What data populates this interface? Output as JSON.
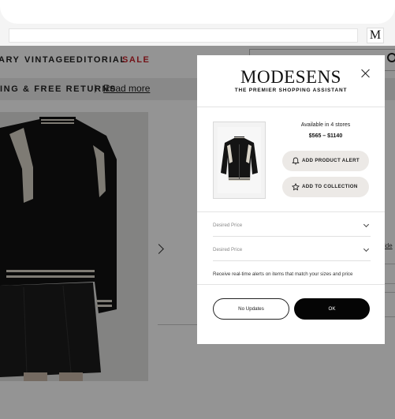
{
  "browser": {
    "extension_icon_letter": "M"
  },
  "nav": {
    "items": [
      {
        "label": "ARY"
      },
      {
        "label": "VINTAGE"
      },
      {
        "label": "EDITORIAL"
      },
      {
        "label": "SALE"
      }
    ]
  },
  "promo": {
    "text": "ING & FREE RETURNS",
    "separator": "|",
    "link": "Read more"
  },
  "page": {
    "size_link_fragment": "ide"
  },
  "modal": {
    "logo": "MODESENS",
    "tagline": "THE PREMIER SHOPPING ASSISTANT",
    "availability": "Available in 4 stores",
    "price_range": "$565 – $1140",
    "add_alert_label": "ADD PRODUCT ALERT",
    "add_collection_label": "ADD TO COLLECTION",
    "fields": [
      {
        "label": "Desired Price"
      },
      {
        "label": "Desired Price"
      }
    ],
    "note": "Receive real-time alerts on items that match your sizes and price",
    "no_updates_label": "No Updates",
    "ok_label": "OK"
  },
  "colors": {
    "sale": "#c8232c",
    "ok_button": "#050505",
    "pill_bg": "#ece9e6"
  },
  "icons": {
    "close": "close-icon",
    "bell": "bell-icon",
    "star": "star-icon",
    "search": "search-icon",
    "next": "chevron-right-icon",
    "chevron_down": "chevron-down-icon"
  }
}
